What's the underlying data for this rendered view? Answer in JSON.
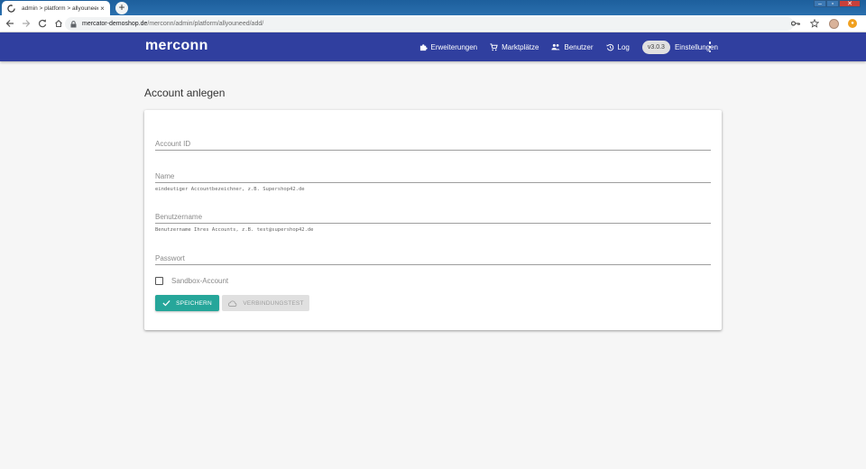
{
  "browser": {
    "tab_title": "admin > platform > allyouneed",
    "tab_close": "×",
    "newtab": "+",
    "url_host": "mercator-demoshop.de",
    "url_path": "/merconn/admin/platform/allyouneed/add/",
    "window_minimize": "–",
    "window_restore": "▫",
    "window_close": "✕"
  },
  "app": {
    "logo": "merconn",
    "menu": {
      "extensions": "Erweiterungen",
      "marketplaces": "Marktplätze",
      "users": "Benutzer",
      "log": "Log",
      "version": "v3.0.3",
      "settings": "Einstellungen"
    }
  },
  "page": {
    "title": "Account anlegen"
  },
  "form": {
    "account_id_placeholder": "Account ID",
    "name_placeholder": "Name",
    "name_hint": "eindeutiger Accountbezeichner, z.B. Supershop42.de",
    "username_placeholder": "Benutzername",
    "username_hint": "Benutzername Ihres Accounts, z.B. test@supershop42.de",
    "password_placeholder": "Passwort",
    "sandbox_label": "Sandbox-Account",
    "save_button": "SPEICHERN",
    "test_button": "VERBINDUNGSTEST"
  },
  "colors": {
    "primary": "#303f9f",
    "accent": "#26a69a",
    "disabled": "#e0e0e0"
  },
  "icons": {
    "extensions": "puzzle-icon",
    "marketplaces": "cart-icon",
    "users": "people-icon",
    "log": "history-icon",
    "save": "check-icon",
    "test": "cloud-icon"
  }
}
